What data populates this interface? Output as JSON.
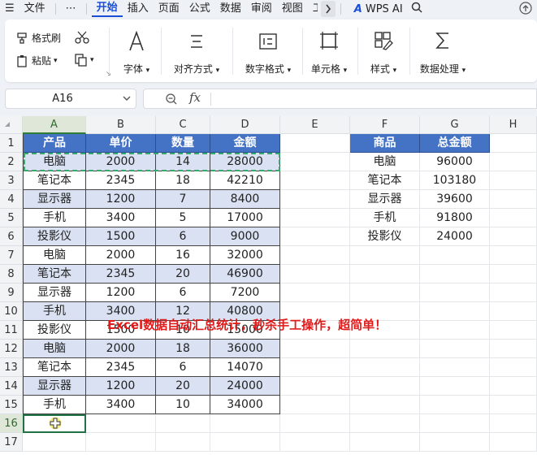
{
  "menubar": {
    "file": "文件",
    "more": "⋯",
    "tabs": [
      "开始",
      "插入",
      "页面",
      "公式",
      "数据",
      "审阅",
      "视图",
      "工"
    ],
    "active_tab": "开始",
    "wps_ai": "WPS AI"
  },
  "ribbon": {
    "format_painter": "格式刷",
    "paste": "粘贴",
    "font": "字体",
    "align": "对齐方式",
    "number_format": "数字格式",
    "cell": "单元格",
    "style": "样式",
    "data_process": "数据处理"
  },
  "formula_bar": {
    "name_box": "A16",
    "fx": "fx",
    "content": ""
  },
  "grid": {
    "columns": [
      "A",
      "B",
      "C",
      "D",
      "E",
      "F",
      "G",
      "H"
    ],
    "rows": [
      "1",
      "2",
      "3",
      "4",
      "5",
      "6",
      "7",
      "8",
      "9",
      "10",
      "11",
      "12",
      "13",
      "14",
      "15",
      "16",
      "17"
    ],
    "selected_cell": "A16"
  },
  "table1": {
    "headers": [
      "产品",
      "单价",
      "数量",
      "金额"
    ],
    "rows": [
      [
        "电脑",
        "2000",
        "14",
        "28000"
      ],
      [
        "笔记本",
        "2345",
        "18",
        "42210"
      ],
      [
        "显示器",
        "1200",
        "7",
        "8400"
      ],
      [
        "手机",
        "3400",
        "5",
        "17000"
      ],
      [
        "投影仪",
        "1500",
        "6",
        "9000"
      ],
      [
        "电脑",
        "2000",
        "16",
        "32000"
      ],
      [
        "笔记本",
        "2345",
        "20",
        "46900"
      ],
      [
        "显示器",
        "1200",
        "6",
        "7200"
      ],
      [
        "手机",
        "3400",
        "12",
        "40800"
      ],
      [
        "投影仪",
        "1500",
        "10",
        "15000"
      ],
      [
        "电脑",
        "2000",
        "18",
        "36000"
      ],
      [
        "笔记本",
        "2345",
        "6",
        "14070"
      ],
      [
        "显示器",
        "1200",
        "20",
        "24000"
      ],
      [
        "手机",
        "3400",
        "10",
        "34000"
      ]
    ]
  },
  "table2": {
    "headers": [
      "商品",
      "总金额"
    ],
    "rows": [
      [
        "电脑",
        "96000"
      ],
      [
        "笔记本",
        "103180"
      ],
      [
        "显示器",
        "39600"
      ],
      [
        "手机",
        "91800"
      ],
      [
        "投影仪",
        "24000"
      ]
    ]
  },
  "caption": "Excel数据自动汇总统计，秒杀手工操作，超简单！",
  "colors": {
    "header_blue": "#4472c4",
    "band_light": "#d9e1f2",
    "accent": "#1a4fd6",
    "caption_red": "#e01b1b"
  }
}
